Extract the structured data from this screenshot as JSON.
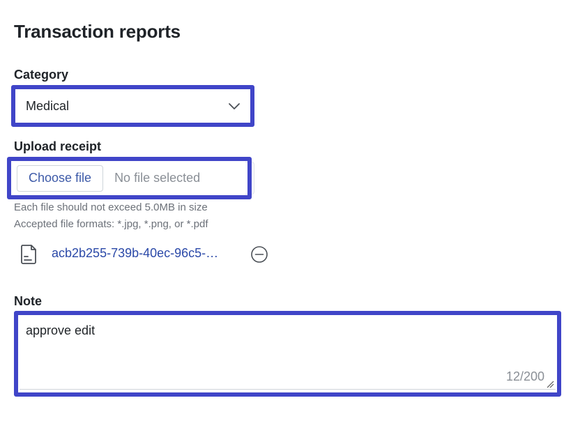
{
  "page": {
    "title": "Transaction reports"
  },
  "category": {
    "label": "Category",
    "selected": "Medical",
    "icon": "chevron-down-icon"
  },
  "upload": {
    "label": "Upload receipt",
    "button_label": "Choose file",
    "status": "No file selected",
    "help_size": "Each file should not exceed 5.0MB in size",
    "help_formats": "Accepted file formats: *.jpg, *.png, or *.pdf"
  },
  "attachment": {
    "file_name": "acb2b255-739b-40ec-96c5-…",
    "file_icon": "file-icon",
    "remove_icon": "minus-circle-icon"
  },
  "note": {
    "label": "Note",
    "value": "approve edit",
    "counter": "12/200"
  },
  "colors": {
    "highlight": "#4045c8",
    "link": "#2b49a8",
    "muted": "#8a8f96"
  }
}
